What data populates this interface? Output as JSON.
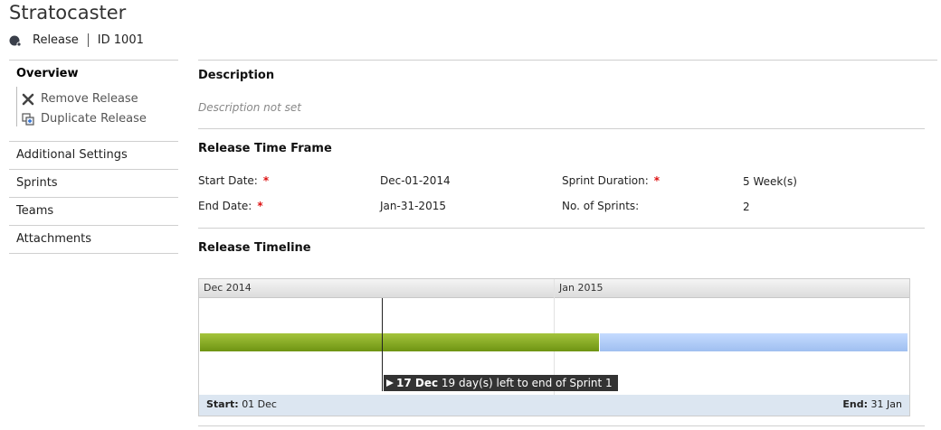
{
  "header": {
    "title": "Stratocaster",
    "type_label": "Release",
    "id_label": "ID 1001"
  },
  "sidebar": {
    "overview": "Overview",
    "actions": [
      {
        "label": "Remove Release",
        "icon": "remove-icon"
      },
      {
        "label": "Duplicate Release",
        "icon": "duplicate-icon"
      }
    ],
    "items": [
      "Additional Settings",
      "Sprints",
      "Teams",
      "Attachments"
    ]
  },
  "description": {
    "title": "Description",
    "text": "Description not set"
  },
  "time_frame": {
    "title": "Release Time Frame",
    "start_label": "Start Date:",
    "start_value": "Dec-01-2014",
    "end_label": "End Date:",
    "end_value": "Jan-31-2015",
    "duration_label": "Sprint Duration:",
    "duration_value": "5 Week(s)",
    "sprints_label": "No. of Sprints:",
    "sprints_value": "2",
    "required_mark": "*"
  },
  "timeline": {
    "title": "Release Timeline",
    "months": [
      "Dec 2014",
      "Jan 2015"
    ],
    "today_date": "17 Dec",
    "today_text": "19 day(s) left to end of Sprint 1",
    "start_label": "Start:",
    "start_value": "01 Dec",
    "end_label": "End:",
    "end_value": "31 Jan",
    "colors": {
      "completed": "#8aab26",
      "remaining": "#b3cdf8"
    }
  }
}
